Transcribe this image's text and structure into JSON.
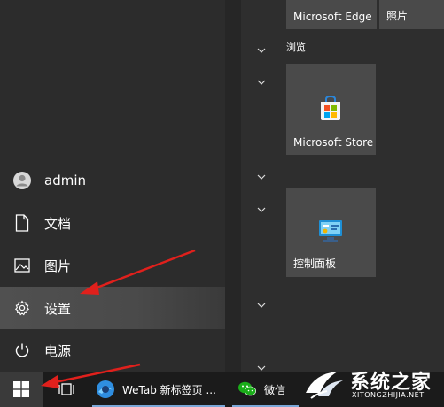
{
  "nav": {
    "user": "admin",
    "documents": "文档",
    "pictures": "图片",
    "settings": "设置",
    "power": "电源"
  },
  "tiles": {
    "edge": "Microsoft Edge",
    "photos": "照片",
    "store": "Microsoft Store",
    "control_panel": "控制面板"
  },
  "groups": {
    "browse": "浏览"
  },
  "taskbar": {
    "wetab": "WeTab 新标签页 ...",
    "wechat": "微信"
  },
  "watermark": {
    "title": "系统之家",
    "subtitle": "XITONGZHIJIA.NET"
  },
  "colors": {
    "arrow": "#e0201c",
    "accent_underline": "#7aa7d8"
  }
}
